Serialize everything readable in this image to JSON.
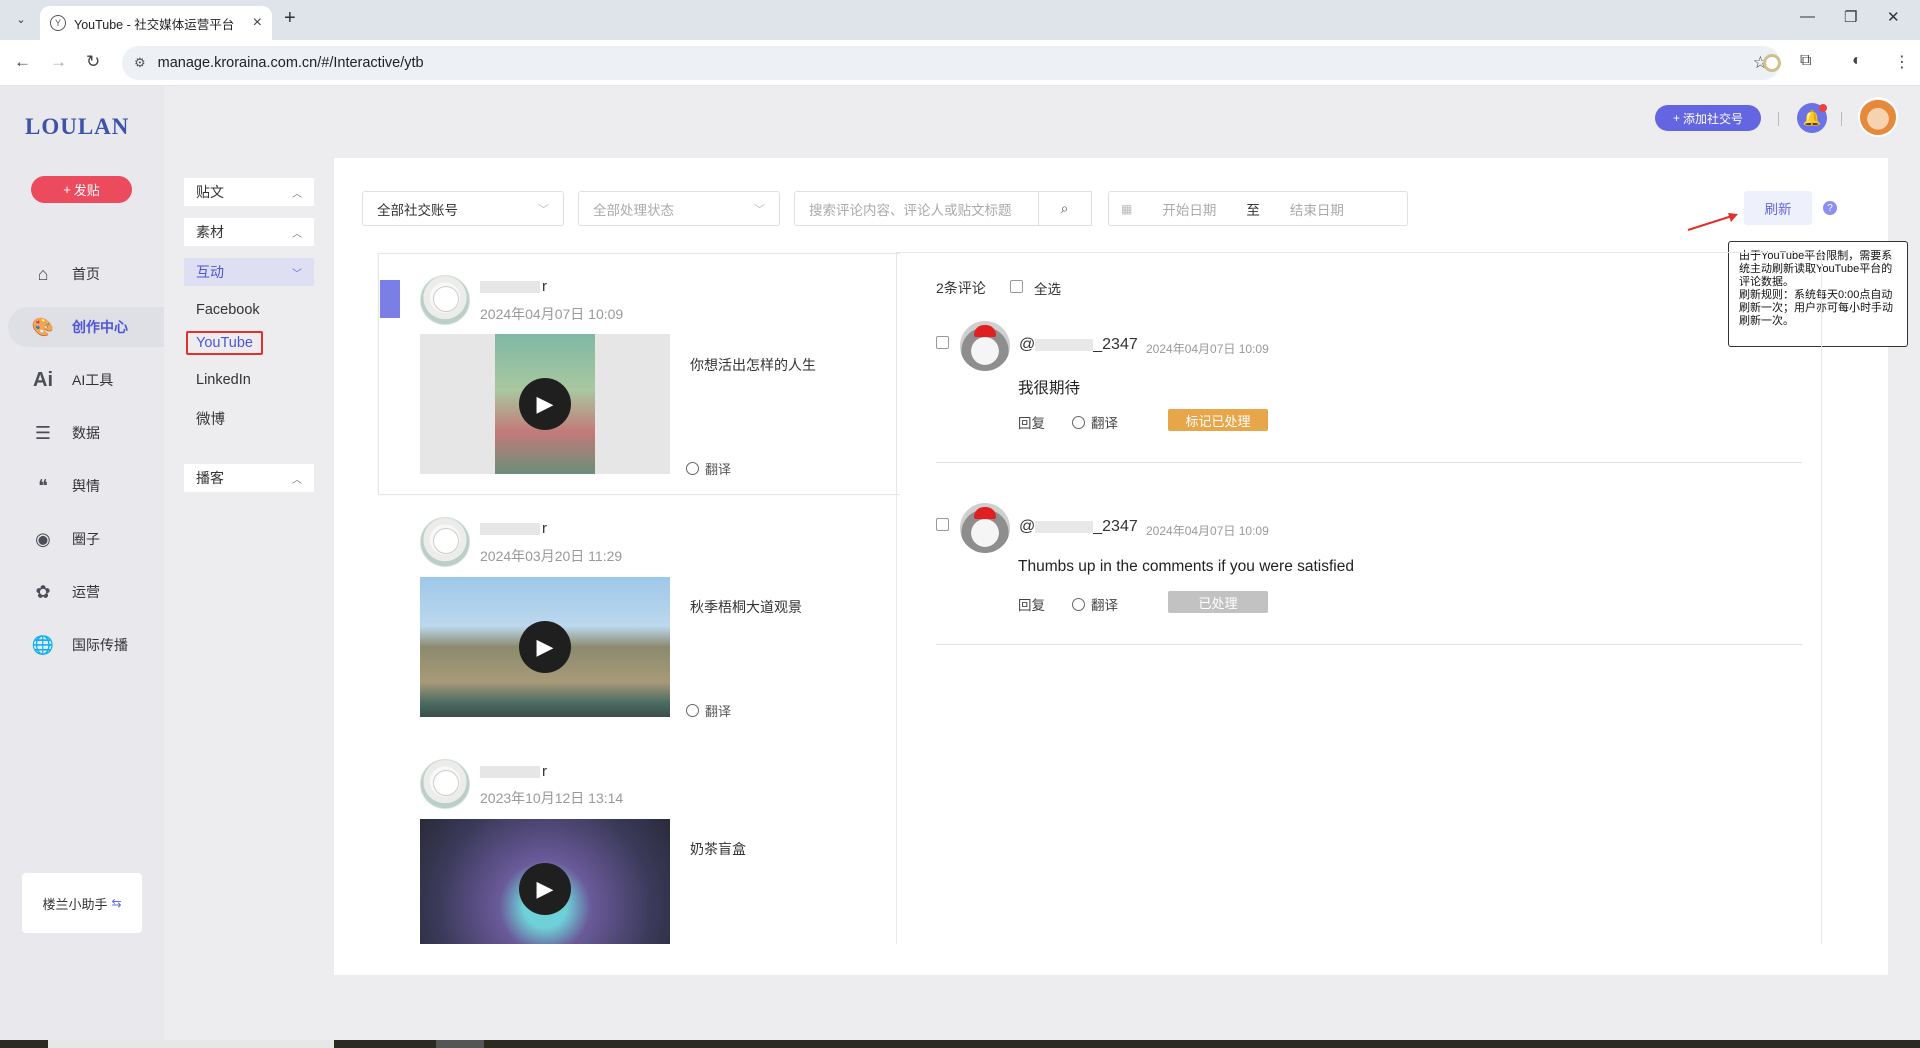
{
  "browser": {
    "tab_title": "YouTube - 社交媒体运营平台",
    "url": "manage.kroraina.com.cn/#/Interactive/ytb"
  },
  "app": {
    "logo": "LOULAN",
    "post_button": "发贴",
    "nav": [
      {
        "label": "首页",
        "icon": "home-icon"
      },
      {
        "label": "创作中心",
        "icon": "palette-icon",
        "active": true
      },
      {
        "label": "AI工具",
        "icon": "ai-icon"
      },
      {
        "label": "数据",
        "icon": "database-icon"
      },
      {
        "label": "舆情",
        "icon": "quote-icon"
      },
      {
        "label": "圈子",
        "icon": "compass-icon"
      },
      {
        "label": "运营",
        "icon": "operations-icon"
      },
      {
        "label": "国际传播",
        "icon": "globe-icon"
      }
    ],
    "helper": "楼兰小助手"
  },
  "subnav": {
    "groups": [
      "贴文",
      "素材",
      "互动",
      "播客"
    ],
    "links": [
      "Facebook",
      "YouTube",
      "LinkedIn",
      "微博"
    ],
    "selected": "YouTube"
  },
  "header": {
    "add_social": "添加社交号"
  },
  "filters": {
    "account": "全部社交账号",
    "status": "全部处理状态",
    "search_placeholder": "搜索评论内容、评论人或贴文标题",
    "start_date": "开始日期",
    "to": "至",
    "end_date": "结束日期",
    "refresh": "刷新",
    "tooltip": "由于YouTube平台限制，需要系统主动刷新读取YouTube平台的评论数据。\n刷新规则：系统每天0:00点自动刷新一次；用户亦可每小时手动刷新一次。"
  },
  "posts": [
    {
      "name_suffix": "r",
      "time": "2024年04月07日 10:09",
      "title": "你想活出怎样的人生",
      "translate": "翻译"
    },
    {
      "name_suffix": "r",
      "time": "2024年03月20日 11:29",
      "title": "秋季梧桐大道观景",
      "translate": "翻译"
    },
    {
      "name_suffix": "r",
      "time": "2023年10月12日 13:14",
      "title": "奶茶盲盒",
      "translate": "翻译"
    }
  ],
  "comments_panel": {
    "count": "2条评论",
    "select_all": "全选"
  },
  "comments": [
    {
      "name_prefix": "@",
      "name_suffix": "_2347",
      "time": "2024年04月07日 10:09",
      "text": "我很期待",
      "reply": "回复",
      "translate": "翻译",
      "status": "标记已处理",
      "status_color": "#e8a64a"
    },
    {
      "name_prefix": "@",
      "name_suffix": "_2347",
      "time": "2024年04月07日 10:09",
      "text": "Thumbs up in the comments if you were satisfied",
      "reply": "回复",
      "translate": "翻译",
      "status": "已处理",
      "status_color": "#c2c2c2"
    }
  ],
  "colors": {
    "accent": "#6366e0",
    "post_button": "#ec4b5e",
    "highlight_border": "#e0322b"
  }
}
